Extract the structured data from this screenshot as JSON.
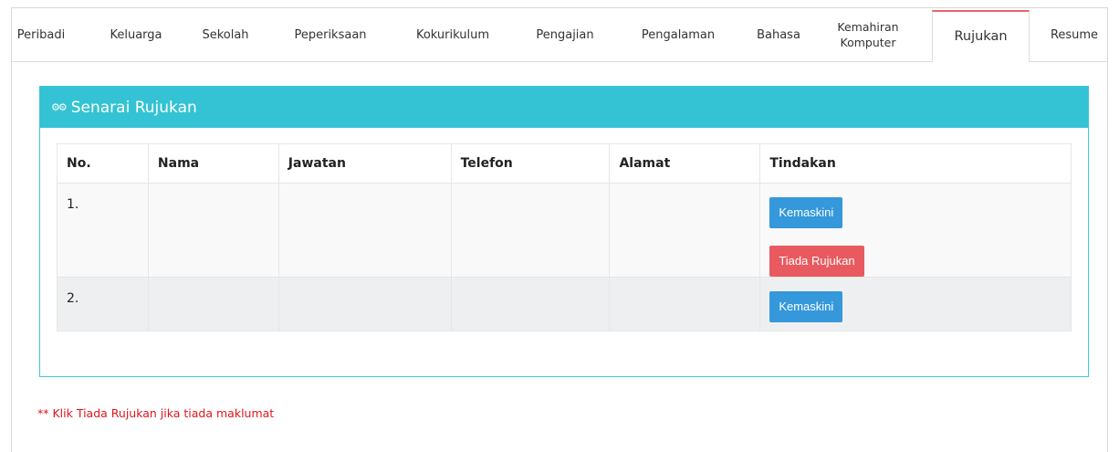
{
  "tabs": [
    {
      "label": "Peribadi"
    },
    {
      "label": "Keluarga"
    },
    {
      "label": "Sekolah"
    },
    {
      "label": "Peperiksaan"
    },
    {
      "label": "Kokurikulum"
    },
    {
      "label": "Pengajian"
    },
    {
      "label": "Pengalaman"
    },
    {
      "label": "Bahasa"
    },
    {
      "label": "Kemahiran",
      "label2": "Komputer"
    },
    {
      "label": "Rujukan",
      "active": true
    },
    {
      "label": "Resume"
    }
  ],
  "panel": {
    "icon": "cogs-icon",
    "title": "Senarai Rujukan"
  },
  "table": {
    "headers": [
      "No.",
      "Nama",
      "Jawatan",
      "Telefon",
      "Alamat",
      "Tindakan"
    ],
    "rows": [
      {
        "no": "1.",
        "nama": "",
        "jawatan": "",
        "telefon": "",
        "alamat": "",
        "actions": [
          "Kemaskini",
          "Tiada Rujukan"
        ]
      },
      {
        "no": "2.",
        "nama": "",
        "jawatan": "",
        "telefon": "",
        "alamat": "",
        "actions": [
          "Kemaskini"
        ]
      }
    ]
  },
  "note": "** Klik Tiada Rujukan jika tiada maklumat",
  "colors": {
    "accent": "#34c3d4",
    "primary_button": "#3498db",
    "danger_button": "#e85a5f",
    "active_tab_border": "#e8636a",
    "note_text": "#e0161c"
  }
}
